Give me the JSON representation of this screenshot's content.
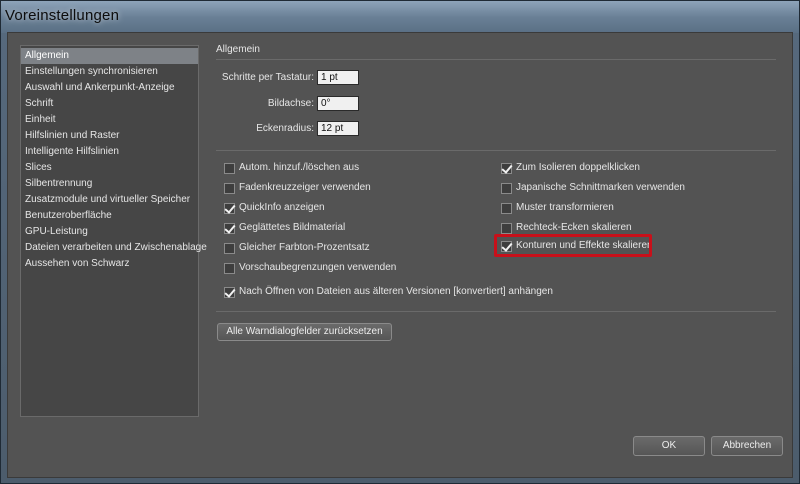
{
  "window": {
    "title": "Voreinstellungen"
  },
  "sidebar": {
    "items": [
      {
        "label": "Allgemein",
        "selected": true
      },
      {
        "label": "Einstellungen synchronisieren"
      },
      {
        "label": "Auswahl und Ankerpunkt-Anzeige"
      },
      {
        "label": "Schrift"
      },
      {
        "label": "Einheit"
      },
      {
        "label": "Hilfslinien und Raster"
      },
      {
        "label": "Intelligente Hilfslinien"
      },
      {
        "label": "Slices"
      },
      {
        "label": "Silbentrennung"
      },
      {
        "label": "Zusatzmodule und virtueller Speicher"
      },
      {
        "label": "Benutzeroberfläche"
      },
      {
        "label": "GPU-Leistung"
      },
      {
        "label": "Dateien verarbeiten und Zwischenablage"
      },
      {
        "label": "Aussehen von Schwarz"
      }
    ]
  },
  "main": {
    "section_title": "Allgemein",
    "fields": [
      {
        "label": "Schritte per Tastatur:",
        "value": "1 pt"
      },
      {
        "label": "Bildachse:",
        "value": "0°"
      },
      {
        "label": "Eckenradius:",
        "value": "12 pt"
      }
    ],
    "checkboxes_left": [
      {
        "label": "Autom. hinzuf./löschen aus",
        "checked": false
      },
      {
        "label": "Fadenkreuzzeiger verwenden",
        "checked": false
      },
      {
        "label": "QuickInfo anzeigen",
        "checked": true
      },
      {
        "label": "Geglättetes Bildmaterial",
        "checked": true
      },
      {
        "label": "Gleicher Farbton-Prozentsatz",
        "checked": false
      },
      {
        "label": "Vorschaubegrenzungen verwenden",
        "checked": false
      }
    ],
    "checkboxes_right": [
      {
        "label": "Zum Isolieren doppelklicken",
        "checked": true
      },
      {
        "label": "Japanische Schnittmarken verwenden",
        "checked": false
      },
      {
        "label": "Muster transformieren",
        "checked": false
      },
      {
        "label": "Rechteck-Ecken skalieren",
        "checked": false
      },
      {
        "label": "Konturen und Effekte skalieren",
        "checked": true,
        "highlighted": true
      }
    ],
    "checkbox_full": {
      "label": "Nach Öffnen von Dateien aus älteren Versionen [konvertiert] anhängen",
      "checked": true
    },
    "reset_button": "Alle Warndialogfelder zurücksetzen"
  },
  "footer": {
    "ok_label": "OK",
    "cancel_label": "Abbrechen"
  },
  "colors": {
    "highlight": "#c8101a",
    "panel": "#535353",
    "selected": "#7e8287"
  }
}
